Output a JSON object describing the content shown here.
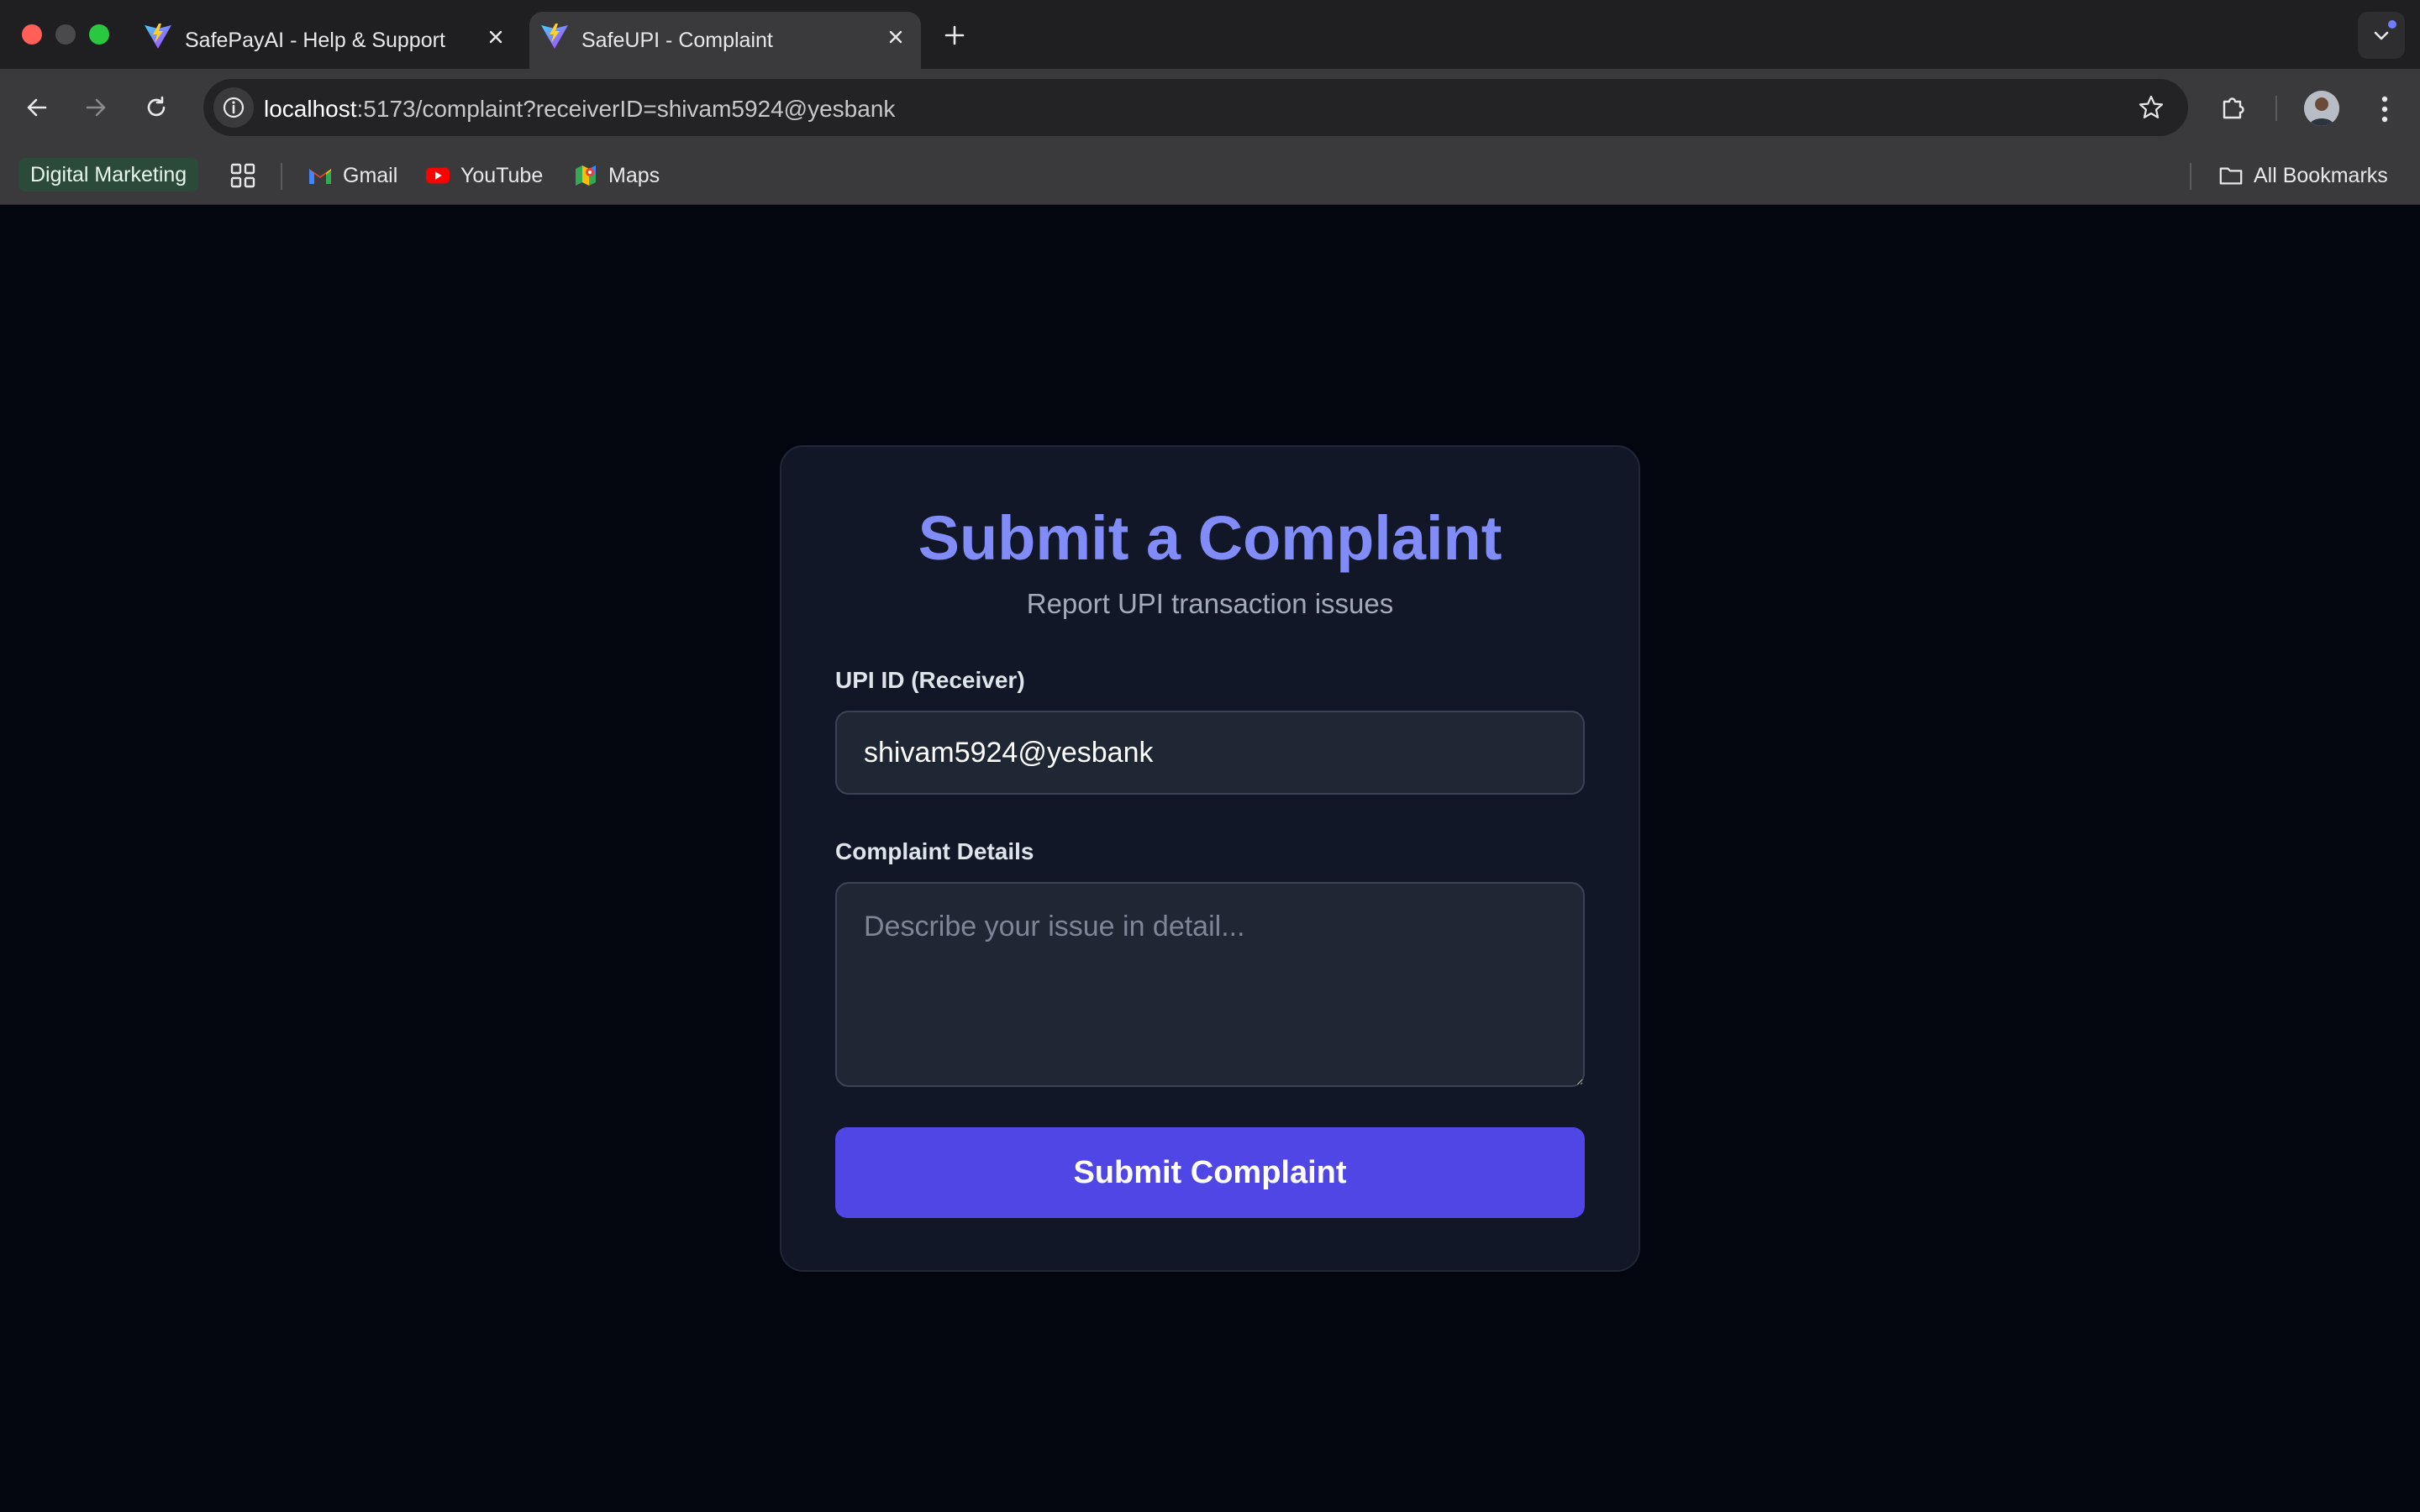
{
  "browser": {
    "tabs": [
      {
        "title": "SafePayAI - Help & Support",
        "favicon": "vite-logo-icon",
        "active": false
      },
      {
        "title": "SafeUPI - Complaint",
        "favicon": "vite-logo-icon",
        "active": true
      }
    ],
    "address_bar": {
      "host": "localhost",
      "path": ":5173/complaint?receiverID=shivam5924@yesbank"
    },
    "bookmarks": {
      "folder_chip": "Digital Marketing",
      "items": [
        {
          "label": "Gmail",
          "icon": "gmail-icon"
        },
        {
          "label": "YouTube",
          "icon": "youtube-icon"
        },
        {
          "label": "Maps",
          "icon": "maps-icon"
        }
      ],
      "all_bookmarks": "All Bookmarks"
    }
  },
  "complaint_form": {
    "title": "Submit a Complaint",
    "subtitle": "Report UPI transaction issues",
    "upi_label": "UPI ID (Receiver)",
    "upi_value": "shivam5924@yesbank",
    "details_label": "Complaint Details",
    "details_placeholder": "Describe your issue in detail...",
    "submit_label": "Submit Complaint",
    "accent_color": "#818cf8",
    "button_color": "#4f46e5"
  }
}
